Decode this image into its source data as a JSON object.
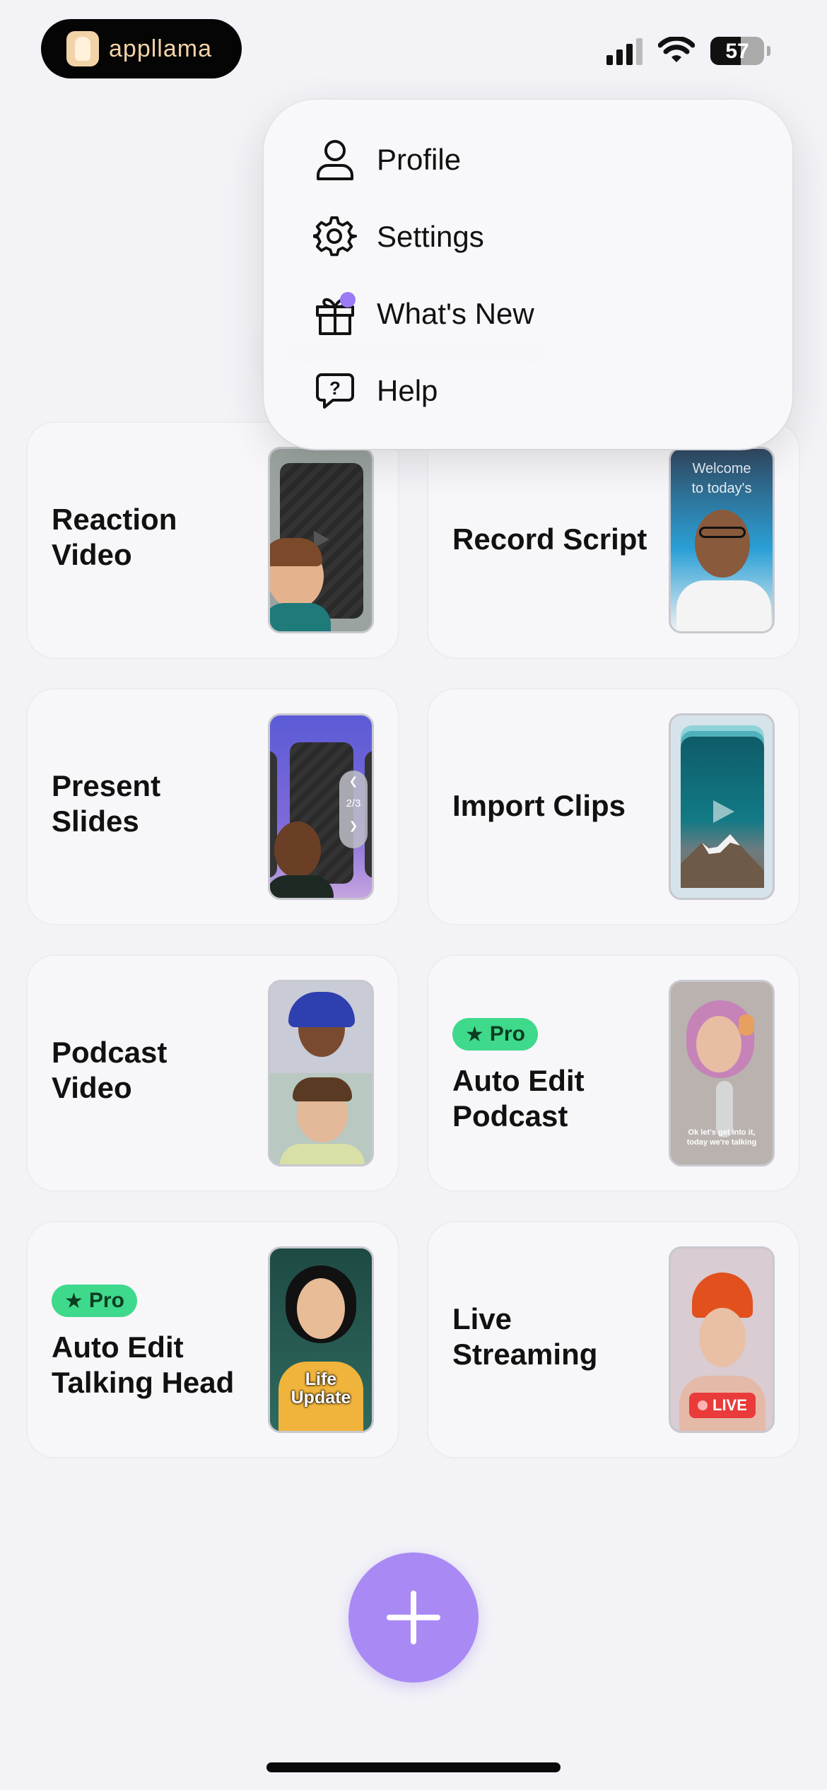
{
  "status_bar": {
    "brand": "appllama",
    "battery": "57",
    "battery_level_percent": 57,
    "signal_bars": 4,
    "icons": [
      "cellular-signal-icon",
      "wifi-icon",
      "battery-icon"
    ]
  },
  "menu": {
    "items": [
      {
        "label": "Profile",
        "icon": "person-icon"
      },
      {
        "label": "Settings",
        "icon": "gear-icon"
      },
      {
        "label": "What's New",
        "icon": "gift-icon",
        "has_badge": true
      },
      {
        "label": "Help",
        "icon": "question-bubble-icon"
      }
    ]
  },
  "cards": {
    "reaction": {
      "title": "Reaction\nVideo"
    },
    "record_script": {
      "title": "Record Script",
      "thumb_caption": "Welcome\nto today's"
    },
    "slides": {
      "title": "Present\nSlides",
      "page_indicator": "2/3"
    },
    "import_clips": {
      "title": "Import Clips"
    },
    "podcast": {
      "title": "Podcast\nVideo"
    },
    "auto_edit_podcast": {
      "badge": "Pro",
      "title": "Auto Edit\nPodcast",
      "thumb_caption": "Ok let's get into it,\ntoday we're talking"
    },
    "auto_edit_talking_head": {
      "badge": "Pro",
      "title": "Auto Edit\nTalking Head",
      "thumb_caption": "Life\nUpdate"
    },
    "live_streaming": {
      "title": "Live\nStreaming",
      "live_label": "LIVE"
    }
  },
  "fab": {
    "icon": "plus-icon"
  },
  "colors": {
    "accent": "#a98af5",
    "pro": "#3fd98c",
    "live": "#ea3b3b",
    "background": "#f2f2f7"
  }
}
